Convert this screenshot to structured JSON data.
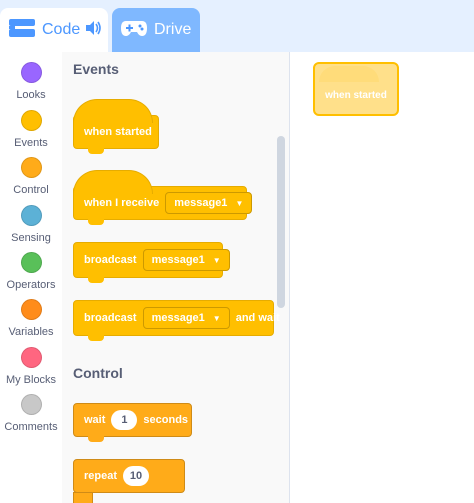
{
  "tabs": {
    "code_label": "Code",
    "drive_label": "Drive"
  },
  "categories": [
    {
      "label": "Looks",
      "color": "#9966ff"
    },
    {
      "label": "Events",
      "color": "#ffbf00"
    },
    {
      "label": "Control",
      "color": "#ffab19"
    },
    {
      "label": "Sensing",
      "color": "#5cb1d6"
    },
    {
      "label": "Operators",
      "color": "#59c059"
    },
    {
      "label": "Variables",
      "color": "#ff8c1a"
    },
    {
      "label": "My Blocks",
      "color": "#ff6680"
    },
    {
      "label": "Comments",
      "color": "#c8c8c8"
    }
  ],
  "palette": {
    "events_title": "Events",
    "control_title": "Control",
    "when_started": "when started",
    "when_i_receive": "when I receive",
    "receive_message": "message1",
    "broadcast": "broadcast",
    "broadcast_message": "message1",
    "broadcast_wait": "broadcast",
    "broadcast_wait_message": "message1",
    "and_wait": "and wait",
    "wait": "wait",
    "wait_value": "1",
    "seconds": "seconds",
    "repeat": "repeat",
    "repeat_value": "10"
  },
  "workspace": {
    "block_label": "when started"
  }
}
